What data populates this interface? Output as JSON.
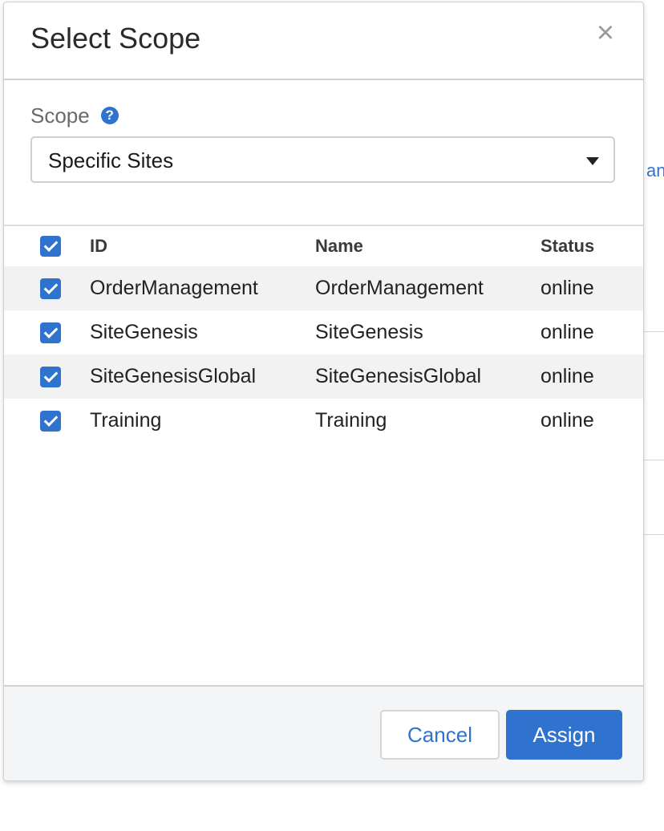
{
  "dialog": {
    "title": "Select Scope",
    "close_glyph": "×"
  },
  "scope": {
    "label": "Scope",
    "help_glyph": "?",
    "selected": "Specific Sites"
  },
  "table": {
    "headers": {
      "id": "ID",
      "name": "Name",
      "status": "Status"
    },
    "select_all_checked": true,
    "rows": [
      {
        "id": "OrderManagement",
        "name": "OrderManagement",
        "status": "online",
        "checked": true
      },
      {
        "id": "SiteGenesis",
        "name": "SiteGenesis",
        "status": "online",
        "checked": true
      },
      {
        "id": "SiteGenesisGlobal",
        "name": "SiteGenesisGlobal",
        "status": "online",
        "checked": true
      },
      {
        "id": "Training",
        "name": "Training",
        "status": "online",
        "checked": true
      }
    ]
  },
  "footer": {
    "cancel_label": "Cancel",
    "assign_label": "Assign"
  },
  "colors": {
    "accent": "#2f73cf",
    "footer_bg": "#f4f5f7",
    "stripe": "#f2f2f2"
  }
}
